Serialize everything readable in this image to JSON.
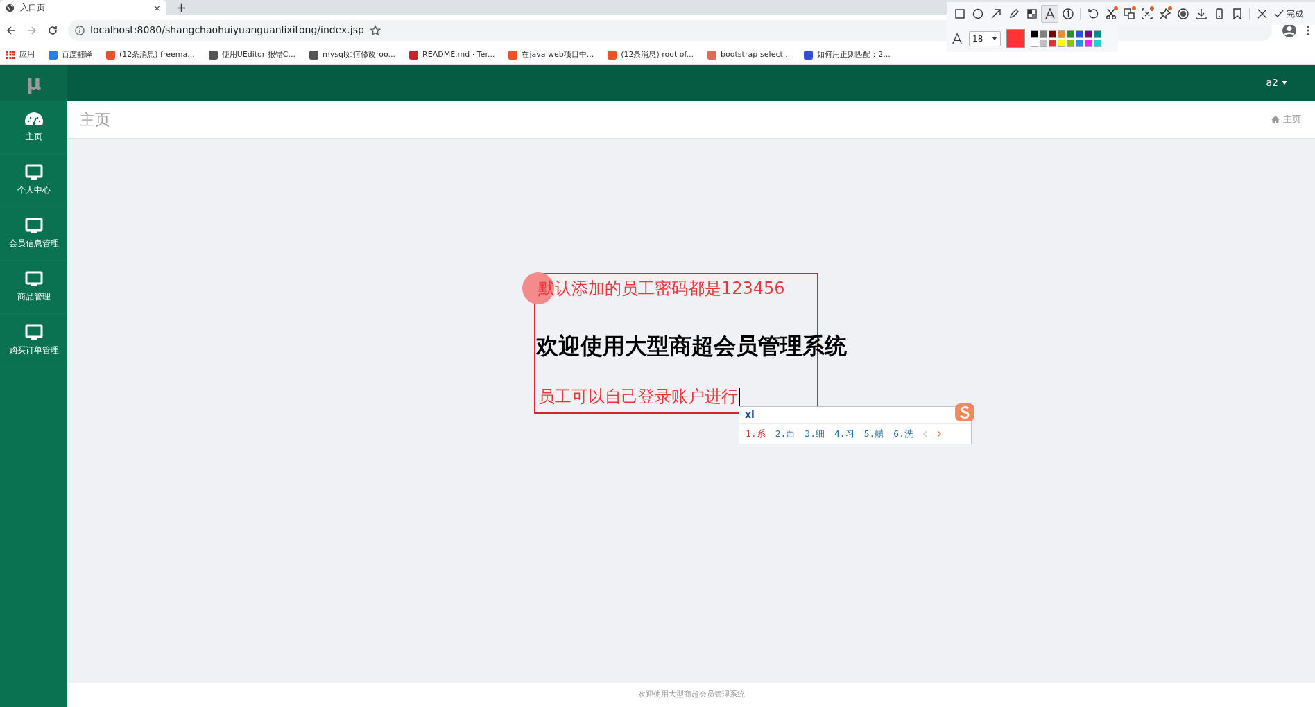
{
  "browser": {
    "tab": {
      "title": "入口页",
      "close": "×"
    },
    "new_tab": "+",
    "address": "localhost:8080/shangchaohuiyuanguanlixitong/index.jsp",
    "bookmarks": [
      {
        "label": "应用",
        "kind": "apps",
        "color": "#d93025"
      },
      {
        "label": "百度翻译",
        "kind": "favicon",
        "color": "#2f7de1"
      },
      {
        "label": "(12条消息) freema...",
        "kind": "favicon",
        "color": "#e8532b"
      },
      {
        "label": "使用UEditor 报错C...",
        "kind": "favicon",
        "color": "#555555"
      },
      {
        "label": "mysql如何修改roo...",
        "kind": "favicon",
        "color": "#555555"
      },
      {
        "label": "README.md · Ter...",
        "kind": "favicon",
        "color": "#c7252e"
      },
      {
        "label": "在java web项目中...",
        "kind": "favicon",
        "color": "#e8532b"
      },
      {
        "label": "(12条消息) root of...",
        "kind": "favicon",
        "color": "#e8532b"
      },
      {
        "label": "bootstrap-select...",
        "kind": "favicon",
        "color": "#e06a55"
      },
      {
        "label": "如何用正则匹配：2...",
        "kind": "favicon",
        "color": "#3050d0"
      }
    ]
  },
  "app": {
    "logo": "μ",
    "user": "a2",
    "sidebar": [
      {
        "label": "主页",
        "kind": "dashboard"
      },
      {
        "label": "个人中心",
        "kind": "monitor"
      },
      {
        "label": "会员信息管理",
        "kind": "monitor"
      },
      {
        "label": "商品管理",
        "kind": "monitor"
      },
      {
        "label": "购买订单管理",
        "kind": "monitor"
      }
    ],
    "page_title": "主页",
    "breadcrumb": "主页",
    "welcome": "欢迎使用大型商超会员管理系统",
    "footer": "欢迎使用大型商超会员管理系统"
  },
  "annotations": [
    {
      "kind": "rectangle",
      "color": "#d9252b"
    },
    {
      "kind": "circle",
      "color": "#f58a8a"
    },
    {
      "kind": "text",
      "color": "#e8383d",
      "text": "默认添加的员工密码都是123456"
    },
    {
      "kind": "text",
      "color": "#e8383d",
      "text": "员工可以自己登录账户进行"
    }
  ],
  "ime": {
    "input": "xi",
    "candidates": [
      {
        "text": "1.系",
        "selected": true
      },
      {
        "text": "2.西",
        "selected": false
      },
      {
        "text": "3.细",
        "selected": false
      },
      {
        "text": "4.习",
        "selected": false
      },
      {
        "text": "5.囍",
        "selected": false
      },
      {
        "text": "6.洗",
        "selected": false
      }
    ]
  },
  "screenshot_toolbar": {
    "tool_groups": [
      [
        {
          "kind": "rectangle",
          "selected": false,
          "dot": false
        },
        {
          "kind": "ellipse",
          "selected": false,
          "dot": false
        },
        {
          "kind": "arrow",
          "selected": false,
          "dot": false
        },
        {
          "kind": "pencil",
          "selected": false,
          "dot": false
        },
        {
          "kind": "mosaic",
          "selected": false,
          "dot": false
        },
        {
          "kind": "text",
          "selected": true,
          "dot": false
        },
        {
          "kind": "number",
          "selected": false,
          "dot": false
        }
      ],
      [
        {
          "kind": "undo",
          "selected": false,
          "dot": false
        },
        {
          "kind": "cut",
          "selected": false,
          "dot": true
        },
        {
          "kind": "translate",
          "selected": false,
          "dot": true
        },
        {
          "kind": "ocr",
          "selected": false,
          "dot": true
        },
        {
          "kind": "pin",
          "selected": false,
          "dot": true
        },
        {
          "kind": "record",
          "selected": false,
          "dot": false
        },
        {
          "kind": "download",
          "selected": false,
          "dot": false
        },
        {
          "kind": "phone",
          "selected": false,
          "dot": false
        },
        {
          "kind": "bookmark",
          "selected": false,
          "dot": false
        }
      ],
      [
        {
          "kind": "close",
          "selected": false,
          "dot": false
        }
      ]
    ],
    "done": "完成",
    "font_size": "18",
    "current_color": {
      "color": "#ff3333"
    },
    "palette": [
      {
        "color": "#000000"
      },
      {
        "color": "#808080"
      },
      {
        "color": "#800000"
      },
      {
        "color": "#f08a30"
      },
      {
        "color": "#2e8b30"
      },
      {
        "color": "#3050e0"
      },
      {
        "color": "#800080"
      },
      {
        "color": "#008b8b"
      },
      {
        "color": "#ffffff"
      },
      {
        "color": "#c0c0c0"
      },
      {
        "color": "#e03535"
      },
      {
        "color": "#ffff00"
      },
      {
        "color": "#90c010"
      },
      {
        "color": "#3090e0"
      },
      {
        "color": "#f020f0"
      },
      {
        "color": "#20d0d0"
      }
    ]
  }
}
